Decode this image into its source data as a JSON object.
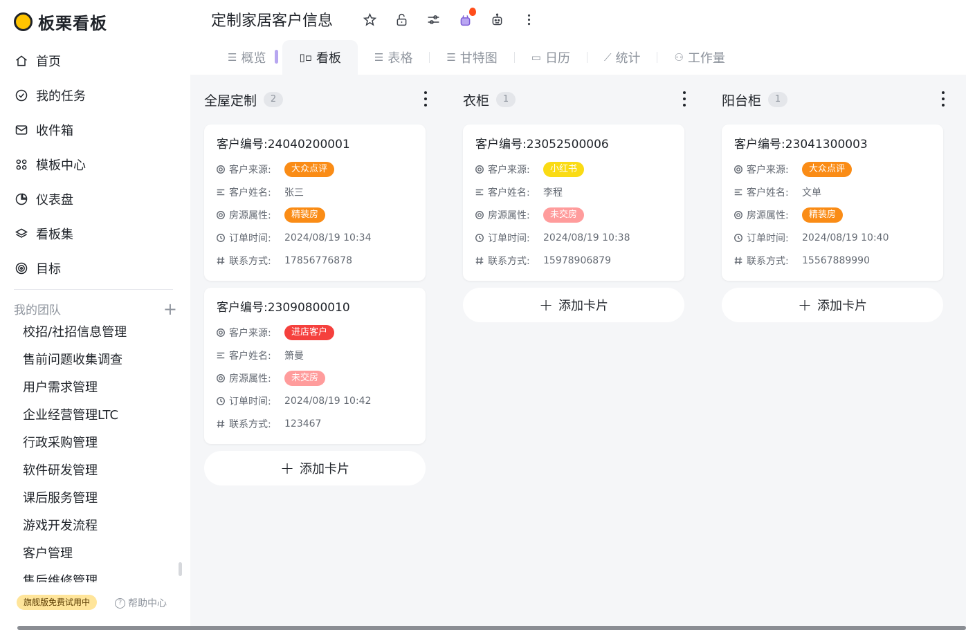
{
  "app": {
    "name": "板栗看板"
  },
  "nav": [
    {
      "label": "首页",
      "icon": "home-icon"
    },
    {
      "label": "我的任务",
      "icon": "check-circle-icon"
    },
    {
      "label": "收件箱",
      "icon": "mail-icon"
    },
    {
      "label": "模板中心",
      "icon": "template-icon"
    },
    {
      "label": "仪表盘",
      "icon": "pie-chart-icon"
    },
    {
      "label": "看板集",
      "icon": "layers-icon"
    },
    {
      "label": "目标",
      "icon": "target-icon"
    }
  ],
  "team": {
    "title": "我的团队",
    "add_label": "+",
    "items": [
      "校招/社招信息管理",
      "售前问题收集调查",
      "用户需求管理",
      "企业经营管理LTC",
      "行政采购管理",
      "软件研发管理",
      "课后服务管理",
      "游戏开发流程",
      "客户管理",
      "售后维修管理"
    ]
  },
  "footer": {
    "trial": "旗舰版免费试用中",
    "help": "帮助中心",
    "help_icon": "?"
  },
  "header": {
    "title": "定制家居客户信息",
    "tools": [
      "star-icon",
      "unlock-icon",
      "sliders-icon",
      "plugin-icon",
      "robot-icon",
      "more-vertical-icon"
    ]
  },
  "tabs": [
    {
      "label": "概览",
      "icon": "☰",
      "active": false
    },
    {
      "label": "看板",
      "icon": "▯▫",
      "active": true
    },
    {
      "label": "表格",
      "icon": "☰",
      "active": false
    },
    {
      "label": "甘特图",
      "icon": "☰",
      "active": false
    },
    {
      "label": "日历",
      "icon": "▭",
      "active": false
    },
    {
      "label": "统计",
      "icon": "⟋",
      "active": false
    },
    {
      "label": "工作量",
      "icon": "⚇",
      "active": false
    }
  ],
  "field_labels": {
    "source": "客户来源:",
    "name": "客户姓名:",
    "property": "房源属性:",
    "time": "订单时间:",
    "contact": "联系方式:"
  },
  "tag_colors": {
    "大众点评": "#fa8c16",
    "小红书": "#fadb14",
    "进店客户": "#f5403d",
    "精装房": "#fa8c16",
    "未交房": "#ff9c9c"
  },
  "add_card_label": "添加卡片",
  "columns": [
    {
      "title": "全屋定制",
      "count": "2",
      "cards": [
        {
          "title": "客户编号:24040200001",
          "source": "大众点评",
          "name": "张三",
          "property": "精装房",
          "time": "2024/08/19 10:34",
          "contact": "17856776878"
        },
        {
          "title": "客户编号:23090800010",
          "source": "进店客户",
          "name": "箫曼",
          "property": "未交房",
          "time": "2024/08/19 10:42",
          "contact": "123467"
        }
      ]
    },
    {
      "title": "衣柜",
      "count": "1",
      "cards": [
        {
          "title": "客户编号:23052500006",
          "source": "小红书",
          "name": "李程",
          "property": "未交房",
          "time": "2024/08/19 10:38",
          "contact": "15978906879"
        }
      ]
    },
    {
      "title": "阳台柜",
      "count": "1",
      "cards": [
        {
          "title": "客户编号:23041300003",
          "source": "大众点评",
          "name": "文单",
          "property": "精装房",
          "time": "2024/08/19 10:40",
          "contact": "15567889990"
        }
      ]
    }
  ]
}
